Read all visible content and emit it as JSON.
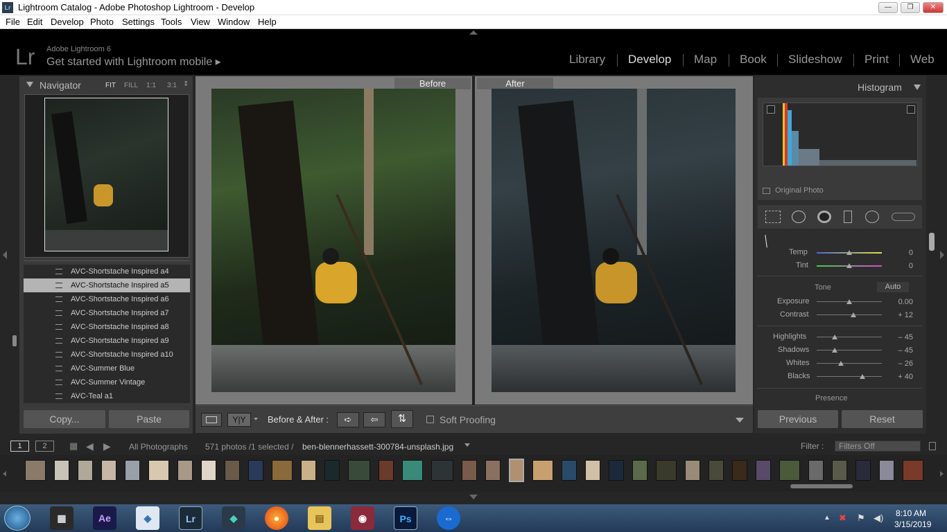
{
  "window": {
    "title": "Lightroom Catalog - Adobe Photoshop Lightroom - Develop",
    "app_icon": "Lr",
    "min": "—",
    "max": "❐",
    "close": "✕"
  },
  "menu": [
    "File",
    "Edit",
    "Develop",
    "Photo",
    "Settings",
    "Tools",
    "View",
    "Window",
    "Help"
  ],
  "header": {
    "logo": "Lr",
    "brand": "Adobe Lightroom 6",
    "mobile": "Get started with Lightroom mobile ▸",
    "modules": [
      "Library",
      "Develop",
      "Map",
      "Book",
      "Slideshow",
      "Print",
      "Web"
    ],
    "active": "Develop"
  },
  "navigator": {
    "title": "Navigator",
    "zoom": [
      "FIT",
      "FILL",
      "1:1",
      "3:1"
    ]
  },
  "presets": [
    {
      "label": "AVC-Shortstache Inspired a4",
      "selected": false
    },
    {
      "label": "AVC-Shortstache Inspired a5",
      "selected": true
    },
    {
      "label": "AVC-Shortstache Inspired a6",
      "selected": false
    },
    {
      "label": "AVC-Shortstache Inspired a7",
      "selected": false
    },
    {
      "label": "AVC-Shortstache Inspired a8",
      "selected": false
    },
    {
      "label": "AVC-Shortstache Inspired a9",
      "selected": false
    },
    {
      "label": "AVC-Shortstache Inspired a10",
      "selected": false
    },
    {
      "label": "AVC-Summer Blue",
      "selected": false
    },
    {
      "label": "AVC-Summer Vintage",
      "selected": false
    },
    {
      "label": "AVC-Teal a1",
      "selected": false
    }
  ],
  "left_buttons": {
    "copy": "Copy...",
    "paste": "Paste"
  },
  "view": {
    "before": "Before",
    "after": "After"
  },
  "toolbar": {
    "yy": "Y|Y",
    "before_after": "Before & After :",
    "soft_proofing": "Soft Proofing"
  },
  "histogram": {
    "title": "Histogram",
    "original_photo": "Original Photo"
  },
  "basic": {
    "temp": {
      "label": "Temp",
      "value": "0",
      "pos": 0.5
    },
    "tint": {
      "label": "Tint",
      "value": "0",
      "pos": 0.5
    },
    "tone": "Tone",
    "auto": "Auto",
    "exposure": {
      "label": "Exposure",
      "value": "0.00",
      "pos": 0.5
    },
    "contrast": {
      "label": "Contrast",
      "value": "+ 12",
      "pos": 0.56
    },
    "highlights": {
      "label": "Highlights",
      "value": "– 45",
      "pos": 0.28
    },
    "shadows": {
      "label": "Shadows",
      "value": "– 45",
      "pos": 0.28
    },
    "whites": {
      "label": "Whites",
      "value": "– 26",
      "pos": 0.37
    },
    "blacks": {
      "label": "Blacks",
      "value": "+ 40",
      "pos": 0.7
    },
    "presence": "Presence"
  },
  "right_buttons": {
    "previous": "Previous",
    "reset": "Reset"
  },
  "filmbar": {
    "page1": "1",
    "page2": "2",
    "source": "All Photographs",
    "count": "571 photos /1 selected /",
    "filename": "ben-blennerhassett-300784-unsplash.jpg",
    "filter_label": "Filter :",
    "filter_value": "Filters Off"
  },
  "taskbar": {
    "time": "8:10 AM",
    "date": "3/15/2019"
  },
  "colors": {
    "accent": "#ddd",
    "bg": "#262626",
    "selected_preset": "#b4b4b4"
  }
}
